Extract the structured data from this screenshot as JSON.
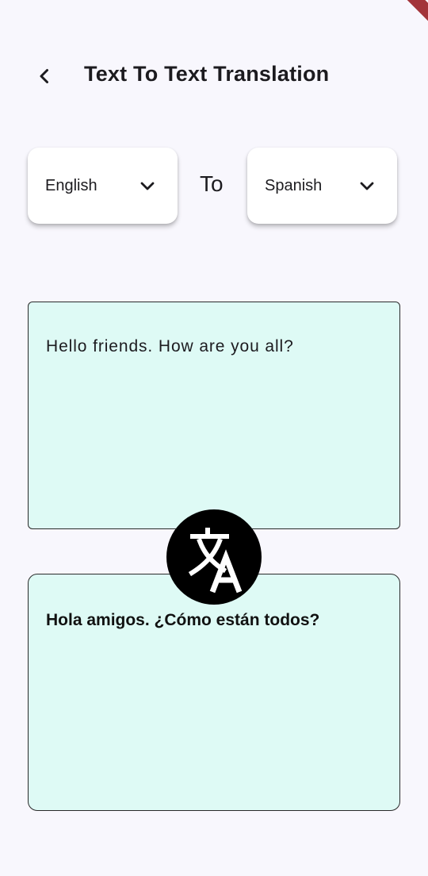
{
  "app_bar": {
    "title": "Text To Text Translation",
    "back_icon": "chevron-left-icon"
  },
  "language_selector": {
    "source": {
      "selected": "English",
      "icon": "chevron-down-icon"
    },
    "connector": "To",
    "target": {
      "selected": "Spanish",
      "icon": "chevron-down-icon"
    }
  },
  "input": {
    "value": "Hello friends. How are you all?"
  },
  "output": {
    "value": "Hola amigos. ¿Cómo están todos?"
  },
  "translate_button": {
    "icon": "translate-icon"
  },
  "colors": {
    "background": "#f8f7fd",
    "text_box_fill": "#defaf5",
    "fab": "#000000",
    "debug_ribbon": "#a3343a"
  }
}
